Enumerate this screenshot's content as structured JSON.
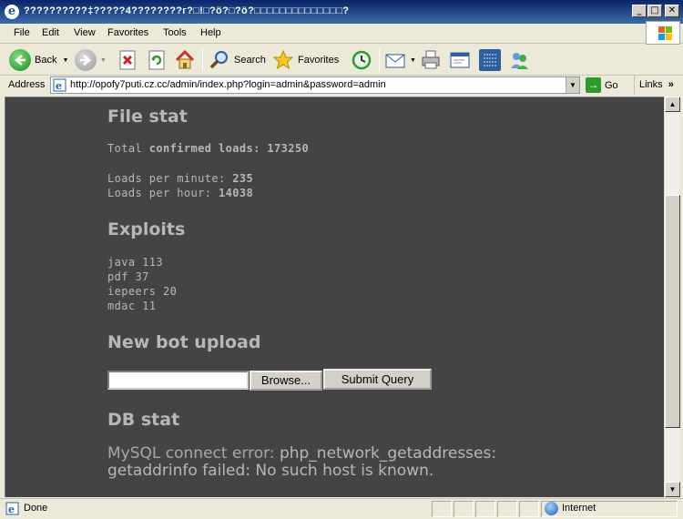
{
  "window": {
    "title": "??????????‡?????4????????г?□!□?ö?□?ö?□□□□□□□□□□□□□□?",
    "ie_icon": "ie-logo-icon"
  },
  "menu": [
    "File",
    "Edit",
    "View",
    "Favorites",
    "Tools",
    "Help"
  ],
  "toolbar": {
    "back_label": "Back",
    "search_label": "Search",
    "favorites_label": "Favorites"
  },
  "address": {
    "label": "Address",
    "url": "http://opofy7puti.cz.cc/admin/index.php?login=admin&password=admin",
    "go_label": "Go",
    "links_label": "Links"
  },
  "page": {
    "file_stat_heading": "File stat",
    "total_prefix": "Total ",
    "total_label": "confirmed loads:",
    "total_value": "173250",
    "loads_per_minute_label": "Loads per minute:",
    "loads_per_minute_value": "235",
    "loads_per_hour_label": "Loads per hour:",
    "loads_per_hour_value": "14038",
    "exploits_heading": "Exploits",
    "exploits": [
      {
        "name": "java",
        "count": "113"
      },
      {
        "name": "pdf",
        "count": "37"
      },
      {
        "name": "iepeers",
        "count": "20"
      },
      {
        "name": "mdac",
        "count": "11"
      }
    ],
    "upload_heading": "New bot upload",
    "file_input_value": "",
    "browse_label": "Browse...",
    "submit_label": "Submit Query",
    "db_heading": "DB stat",
    "db_error_prefix": "MySQL connect error: ",
    "db_error_bold": "php_network_getaddresses:",
    "db_error_rest": "getaddrinfo failed: No such host is known."
  },
  "status": {
    "text": "Done",
    "zone": "Internet"
  }
}
